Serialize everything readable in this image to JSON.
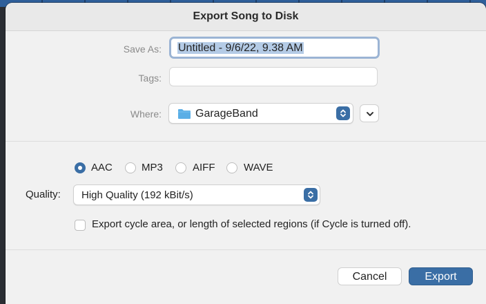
{
  "dialog": {
    "title": "Export Song to Disk"
  },
  "form": {
    "save_as_label": "Save As:",
    "save_as_value": "Untitled - 9/6/22, 9.38 AM",
    "tags_label": "Tags:",
    "tags_value": "",
    "where_label": "Where:",
    "where_value": "GarageBand"
  },
  "format": {
    "options": [
      "AAC",
      "MP3",
      "AIFF",
      "WAVE"
    ],
    "selected": "AAC"
  },
  "quality": {
    "label": "Quality:",
    "value": "High Quality (192 kBit/s)"
  },
  "cycle": {
    "label": "Export cycle area, or length of selected regions (if Cycle is turned off).",
    "checked": false
  },
  "buttons": {
    "cancel": "Cancel",
    "export": "Export"
  },
  "colors": {
    "accent": "#3a6ea5",
    "folder": "#5aaee6"
  },
  "icons": {
    "folder": "folder-icon",
    "stepper": "up-down-stepper-icon",
    "expand": "chevron-down-icon"
  }
}
